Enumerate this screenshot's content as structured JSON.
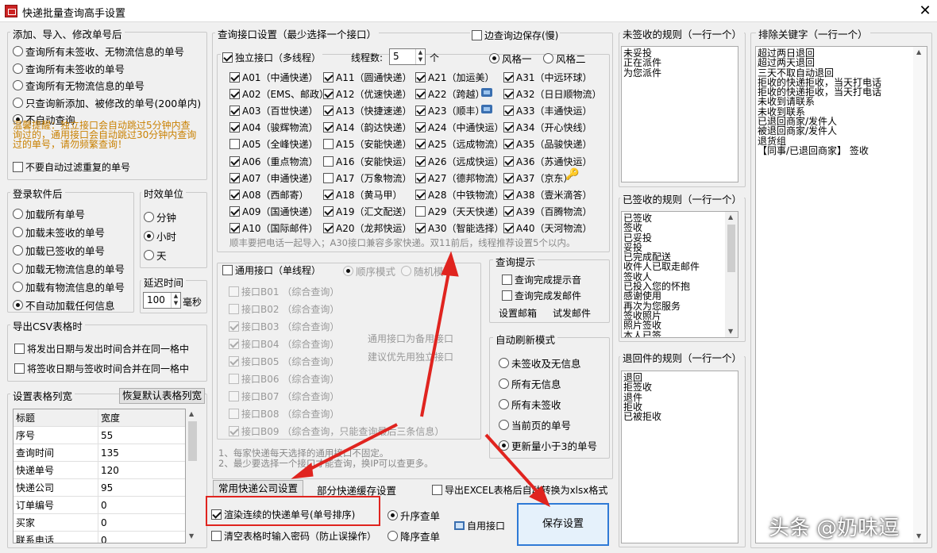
{
  "window": {
    "title": "快递批量查询高手设置",
    "close": "✕"
  },
  "add_section": {
    "title": "添加、导入、修改单号后",
    "options": [
      "查询所有未签收、无物流信息的单号",
      "查询所有未签收的单号",
      "查询所有无物流信息的单号",
      "只查询新添加、被修改的单号(200单内)",
      "不自动查询"
    ],
    "selected": 4,
    "warning": [
      "温馨提醒：独立接口会自动跳过5分钟内查",
      "询过的，通用接口会自动跳过30分钟内查询",
      "过的单号，请勿频繁查询！"
    ],
    "filter_dup": "不要自动过滤重复的单号"
  },
  "login_section": {
    "title": "登录软件后",
    "options": [
      "加载所有单号",
      "加载未签收的单号",
      "加载已签收的单号",
      "加载无物流信息的单号",
      "加载有物流信息的单号",
      "不自动加载任何信息"
    ],
    "selected": 5
  },
  "time_unit": {
    "title": "时效单位",
    "options": [
      "分钟",
      "小时",
      "天"
    ],
    "selected": 1
  },
  "delay": {
    "title": "延迟时间",
    "value": "100",
    "unit": "毫秒"
  },
  "csv": {
    "title": "导出CSV表格时",
    "options": [
      "将发出日期与发出时间合并在同一格中",
      "将签收日期与签收时间合并在同一格中"
    ]
  },
  "columns": {
    "title": "设置表格列宽",
    "reset_label": "恢复默认表格列宽",
    "header": [
      "标题",
      "宽度"
    ],
    "rows": [
      [
        "序号",
        "55"
      ],
      [
        "查询时间",
        "135"
      ],
      [
        "快递单号",
        "120"
      ],
      [
        "快递公司",
        "95"
      ],
      [
        "订单编号",
        "0"
      ],
      [
        "买家",
        "0"
      ],
      [
        "联系电话",
        "0"
      ]
    ]
  },
  "api": {
    "title": "查询接口设置（最少选择一个接口）",
    "save_while": "边查询边保存(慢)",
    "independent": "独立接口（多线程）",
    "threads_label": "线程数:",
    "threads": "5",
    "threads_unit": "个",
    "style1": "风格一",
    "style2": "风格二",
    "items": [
      {
        "code": "A01",
        "name": "中通快递",
        "on": true
      },
      {
        "code": "A11",
        "name": "圆通快递",
        "on": true
      },
      {
        "code": "A21",
        "name": "加运美",
        "on": true
      },
      {
        "code": "A31",
        "name": "中远环球",
        "on": true
      },
      {
        "code": "A02",
        "name": "EMS、邮政",
        "on": true
      },
      {
        "code": "A12",
        "name": "优速快递",
        "on": true
      },
      {
        "code": "A22",
        "name": "跨越",
        "on": true
      },
      {
        "code": "A32",
        "name": "日日顺物流",
        "on": true
      },
      {
        "code": "A03",
        "name": "百世快递",
        "on": true
      },
      {
        "code": "A13",
        "name": "快捷速递",
        "on": true
      },
      {
        "code": "A23",
        "name": "顺丰",
        "on": true
      },
      {
        "code": "A33",
        "name": "丰通快运",
        "on": true
      },
      {
        "code": "A04",
        "name": "骏辉物流",
        "on": true
      },
      {
        "code": "A14",
        "name": "韵达快递",
        "on": true
      },
      {
        "code": "A24",
        "name": "中通快运",
        "on": true
      },
      {
        "code": "A34",
        "name": "开心快线",
        "on": true
      },
      {
        "code": "A05",
        "name": "全峰快递",
        "on": false
      },
      {
        "code": "A15",
        "name": "安能快递",
        "on": false
      },
      {
        "code": "A25",
        "name": "远成物流",
        "on": true
      },
      {
        "code": "A35",
        "name": "品骏快递",
        "on": true
      },
      {
        "code": "A06",
        "name": "重点物流",
        "on": true
      },
      {
        "code": "A16",
        "name": "安能快运",
        "on": false
      },
      {
        "code": "A26",
        "name": "远成快运",
        "on": true
      },
      {
        "code": "A36",
        "name": "苏通快运",
        "on": true
      },
      {
        "code": "A07",
        "name": "申通快递",
        "on": true
      },
      {
        "code": "A17",
        "name": "万象物流",
        "on": false
      },
      {
        "code": "A27",
        "name": "德邦物流",
        "on": true
      },
      {
        "code": "A37",
        "name": "京东",
        "on": true
      },
      {
        "code": "A08",
        "name": "西邮寄",
        "on": true
      },
      {
        "code": "A18",
        "name": "黄马甲",
        "on": true
      },
      {
        "code": "A28",
        "name": "中铁物流",
        "on": true
      },
      {
        "code": "A38",
        "name": "壹米滴答",
        "on": true
      },
      {
        "code": "A09",
        "name": "国通快递",
        "on": true
      },
      {
        "code": "A19",
        "name": "汇文配送",
        "on": true
      },
      {
        "code": "A29",
        "name": "天天快递",
        "on": false
      },
      {
        "code": "A39",
        "name": "百腾物流",
        "on": true
      },
      {
        "code": "A10",
        "name": "国际邮件",
        "on": true
      },
      {
        "code": "A20",
        "name": "龙邦快运",
        "on": true
      },
      {
        "code": "A30",
        "name": "智能选择",
        "on": true
      },
      {
        "code": "A40",
        "name": "天河物流",
        "on": true
      }
    ],
    "note": "顺丰要把电话一起导入；A30接口兼容多家快递。双11前后，线程推荐设置5个以内。",
    "general": "通用接口（单线程）",
    "seq_mode": "顺序模式",
    "rand_mode": "随机模",
    "b_items": [
      {
        "label": "接口B01 （综合查询）",
        "on": false
      },
      {
        "label": "接口B02 （综合查询）",
        "on": false
      },
      {
        "label": "接口B03 （综合查询）",
        "on": true
      },
      {
        "label": "接口B04 （综合查询）",
        "on": true
      },
      {
        "label": "接口B05 （综合查询）",
        "on": true
      },
      {
        "label": "接口B06 （综合查询）",
        "on": false
      },
      {
        "label": "接口B07 （综合查询）",
        "on": false
      },
      {
        "label": "接口B08 （综合查询）",
        "on": false
      },
      {
        "label": "接口B09 （综合查询，只能查询最后三条信息）",
        "on": true
      }
    ],
    "general_hint1": "通用接口为备用接口",
    "general_hint2": "建议优先用独立接口",
    "footnote1": "1、每家快递每天选择的通用接口不固定。",
    "footnote2": "2、最少要选择一个接口才能查询，换IP可以查更多。"
  },
  "query_tip": {
    "title": "查询提示",
    "done_sound": "查询完成提示音",
    "done_mail": "查询完成发邮件",
    "set_mail": "设置邮箱",
    "test_mail": "试发邮件"
  },
  "auto_refresh": {
    "title": "自动刷新模式",
    "options": [
      "未签收及无信息",
      "所有无信息",
      "所有未签收",
      "当前页的单号",
      "更新量小于3的单号"
    ],
    "selected": 4
  },
  "unsigned_rules": {
    "title": "未签收的规则（一行一个）",
    "lines": [
      "未妥投",
      "正在派件",
      "为您派件"
    ]
  },
  "signed_rules": {
    "title": "已签收的规则（一行一个）",
    "lines": [
      "已签收",
      "签收",
      "已妥投",
      "妥投",
      "已完成配送",
      "收件人已取走邮件",
      "签收人",
      "已投入您的怀抱",
      "感谢使用",
      "再次为您服务",
      "签收照片",
      "照片签收",
      "本人已签"
    ]
  },
  "return_rules": {
    "title": "退回件的规则（一行一个）",
    "lines": [
      "退回",
      "拒签收",
      "退件",
      "拒收",
      "已被拒收"
    ]
  },
  "exclude": {
    "title": "排除关键字（一行一个）",
    "lines": [
      "超过两日退回",
      "超过两天退回",
      "三天不取自动退回",
      "拒收的快递拒收，当天打电话",
      "拒收的快递拒收，当天打电话",
      "未收到请联系",
      "未收到联系",
      "已退回商家/发件人",
      "被退回商家/发件人",
      "退货组",
      "【同事/已退回商家】 签收"
    ]
  },
  "bottom": {
    "tab_common": "常用快递公司设置",
    "tab_cache": "部分快递缓存设置",
    "export_xlsx": "导出EXCEL表格后自动转换为xlsx格式",
    "render": "渲染连续的快递单号(单号排序)",
    "asc": "升序查单",
    "desc": "降序查单",
    "clear_pwd": "清空表格时输入密码（防止误操作）",
    "self_api": "自用接口",
    "save": "保存设置"
  },
  "watermark": "头条 @奶味逗"
}
